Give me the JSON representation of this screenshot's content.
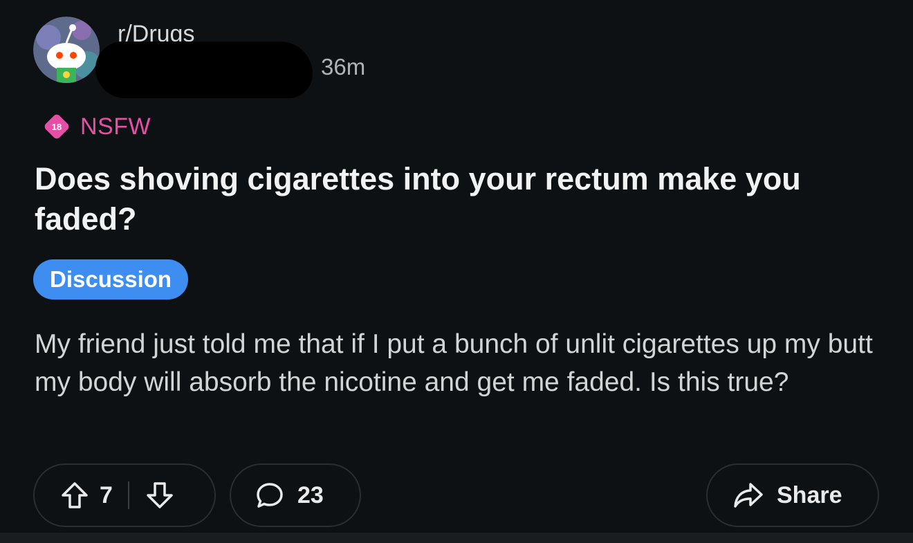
{
  "post": {
    "subreddit": "r/Drugs",
    "time_ago": "36m",
    "nsfw_badge_number": "18",
    "nsfw_label": "NSFW",
    "title": "Does shoving cigarettes into your rectum make you faded?",
    "flair": "Discussion",
    "body": "My friend just told me that if I put a bunch of unlit cigarettes up my butt my body will absorb the nicotine and get me faded. Is this true?"
  },
  "actions": {
    "score": "7",
    "comments": "23",
    "share_label": "Share"
  },
  "icons": {
    "avatar": "snoo-avatar-icon",
    "nsfw": "nsfw-18-icon",
    "upvote": "upvote-arrow-icon",
    "downvote": "downvote-arrow-icon",
    "comment": "comment-bubble-icon",
    "share": "share-arrow-icon"
  },
  "colors": {
    "background": "#0e1113",
    "nsfw": "#e64fa6",
    "flair": "#3e8ef2",
    "text": "#e8eaeb"
  }
}
